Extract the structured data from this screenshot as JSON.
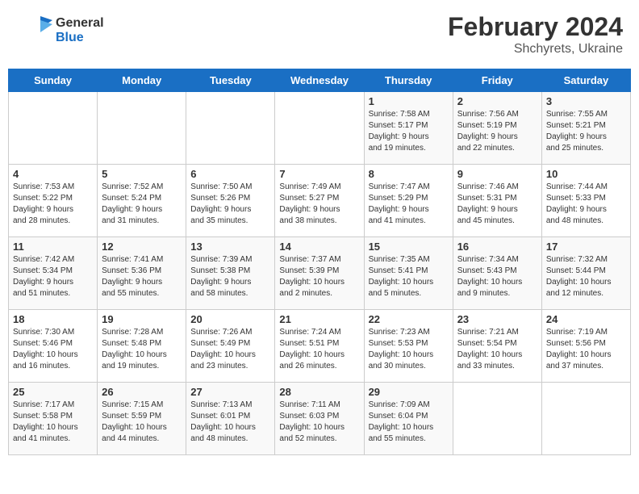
{
  "header": {
    "logo_line1": "General",
    "logo_line2": "Blue",
    "month_year": "February 2024",
    "location": "Shchyrets, Ukraine"
  },
  "weekdays": [
    "Sunday",
    "Monday",
    "Tuesday",
    "Wednesday",
    "Thursday",
    "Friday",
    "Saturday"
  ],
  "weeks": [
    [
      {
        "day": "",
        "info": ""
      },
      {
        "day": "",
        "info": ""
      },
      {
        "day": "",
        "info": ""
      },
      {
        "day": "",
        "info": ""
      },
      {
        "day": "1",
        "info": "Sunrise: 7:58 AM\nSunset: 5:17 PM\nDaylight: 9 hours\nand 19 minutes."
      },
      {
        "day": "2",
        "info": "Sunrise: 7:56 AM\nSunset: 5:19 PM\nDaylight: 9 hours\nand 22 minutes."
      },
      {
        "day": "3",
        "info": "Sunrise: 7:55 AM\nSunset: 5:21 PM\nDaylight: 9 hours\nand 25 minutes."
      }
    ],
    [
      {
        "day": "4",
        "info": "Sunrise: 7:53 AM\nSunset: 5:22 PM\nDaylight: 9 hours\nand 28 minutes."
      },
      {
        "day": "5",
        "info": "Sunrise: 7:52 AM\nSunset: 5:24 PM\nDaylight: 9 hours\nand 31 minutes."
      },
      {
        "day": "6",
        "info": "Sunrise: 7:50 AM\nSunset: 5:26 PM\nDaylight: 9 hours\nand 35 minutes."
      },
      {
        "day": "7",
        "info": "Sunrise: 7:49 AM\nSunset: 5:27 PM\nDaylight: 9 hours\nand 38 minutes."
      },
      {
        "day": "8",
        "info": "Sunrise: 7:47 AM\nSunset: 5:29 PM\nDaylight: 9 hours\nand 41 minutes."
      },
      {
        "day": "9",
        "info": "Sunrise: 7:46 AM\nSunset: 5:31 PM\nDaylight: 9 hours\nand 45 minutes."
      },
      {
        "day": "10",
        "info": "Sunrise: 7:44 AM\nSunset: 5:33 PM\nDaylight: 9 hours\nand 48 minutes."
      }
    ],
    [
      {
        "day": "11",
        "info": "Sunrise: 7:42 AM\nSunset: 5:34 PM\nDaylight: 9 hours\nand 51 minutes."
      },
      {
        "day": "12",
        "info": "Sunrise: 7:41 AM\nSunset: 5:36 PM\nDaylight: 9 hours\nand 55 minutes."
      },
      {
        "day": "13",
        "info": "Sunrise: 7:39 AM\nSunset: 5:38 PM\nDaylight: 9 hours\nand 58 minutes."
      },
      {
        "day": "14",
        "info": "Sunrise: 7:37 AM\nSunset: 5:39 PM\nDaylight: 10 hours\nand 2 minutes."
      },
      {
        "day": "15",
        "info": "Sunrise: 7:35 AM\nSunset: 5:41 PM\nDaylight: 10 hours\nand 5 minutes."
      },
      {
        "day": "16",
        "info": "Sunrise: 7:34 AM\nSunset: 5:43 PM\nDaylight: 10 hours\nand 9 minutes."
      },
      {
        "day": "17",
        "info": "Sunrise: 7:32 AM\nSunset: 5:44 PM\nDaylight: 10 hours\nand 12 minutes."
      }
    ],
    [
      {
        "day": "18",
        "info": "Sunrise: 7:30 AM\nSunset: 5:46 PM\nDaylight: 10 hours\nand 16 minutes."
      },
      {
        "day": "19",
        "info": "Sunrise: 7:28 AM\nSunset: 5:48 PM\nDaylight: 10 hours\nand 19 minutes."
      },
      {
        "day": "20",
        "info": "Sunrise: 7:26 AM\nSunset: 5:49 PM\nDaylight: 10 hours\nand 23 minutes."
      },
      {
        "day": "21",
        "info": "Sunrise: 7:24 AM\nSunset: 5:51 PM\nDaylight: 10 hours\nand 26 minutes."
      },
      {
        "day": "22",
        "info": "Sunrise: 7:23 AM\nSunset: 5:53 PM\nDaylight: 10 hours\nand 30 minutes."
      },
      {
        "day": "23",
        "info": "Sunrise: 7:21 AM\nSunset: 5:54 PM\nDaylight: 10 hours\nand 33 minutes."
      },
      {
        "day": "24",
        "info": "Sunrise: 7:19 AM\nSunset: 5:56 PM\nDaylight: 10 hours\nand 37 minutes."
      }
    ],
    [
      {
        "day": "25",
        "info": "Sunrise: 7:17 AM\nSunset: 5:58 PM\nDaylight: 10 hours\nand 41 minutes."
      },
      {
        "day": "26",
        "info": "Sunrise: 7:15 AM\nSunset: 5:59 PM\nDaylight: 10 hours\nand 44 minutes."
      },
      {
        "day": "27",
        "info": "Sunrise: 7:13 AM\nSunset: 6:01 PM\nDaylight: 10 hours\nand 48 minutes."
      },
      {
        "day": "28",
        "info": "Sunrise: 7:11 AM\nSunset: 6:03 PM\nDaylight: 10 hours\nand 52 minutes."
      },
      {
        "day": "29",
        "info": "Sunrise: 7:09 AM\nSunset: 6:04 PM\nDaylight: 10 hours\nand 55 minutes."
      },
      {
        "day": "",
        "info": ""
      },
      {
        "day": "",
        "info": ""
      }
    ]
  ]
}
